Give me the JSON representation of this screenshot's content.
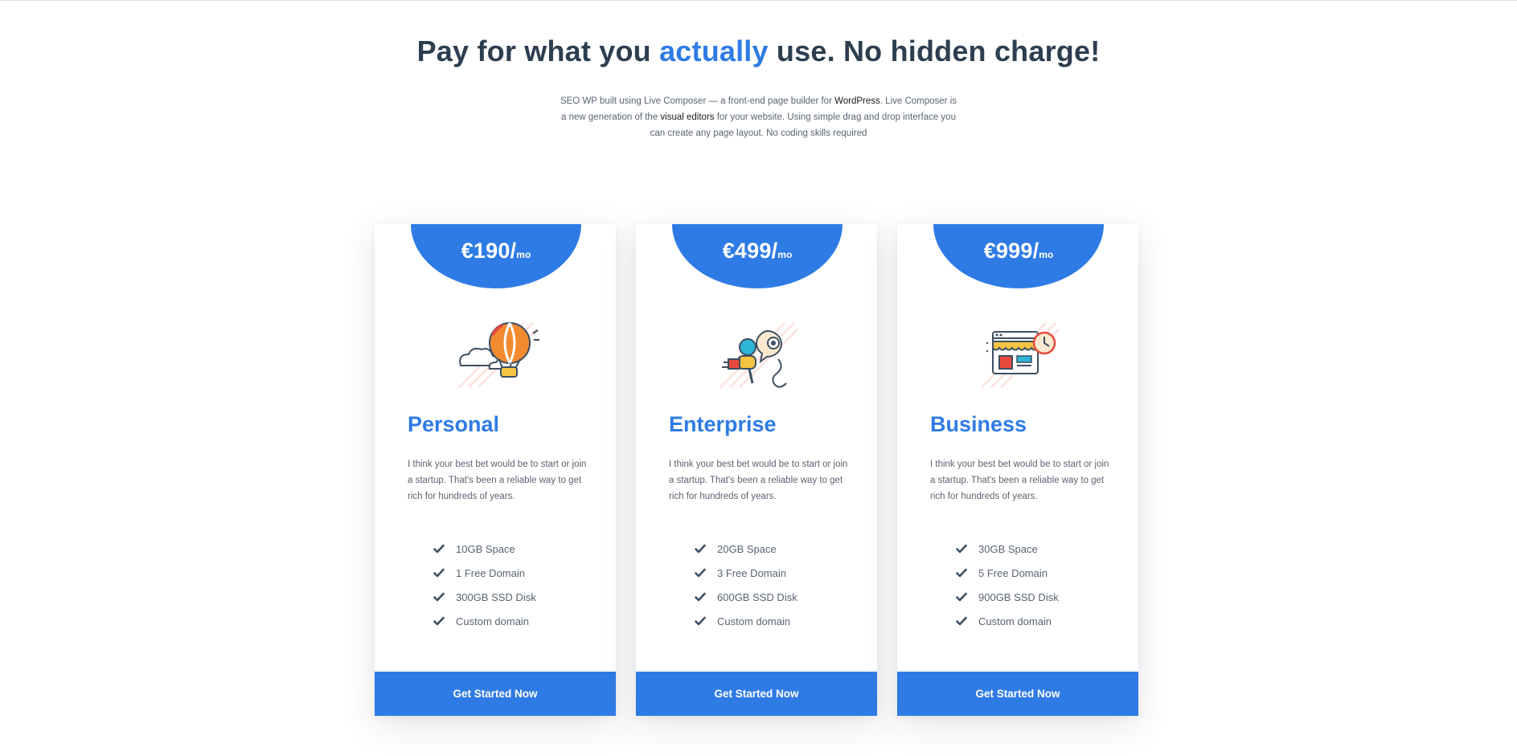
{
  "header": {
    "headline_before": "Pay for what you ",
    "headline_accent": "actually",
    "headline_after": " use. No hidden charge!",
    "intro_part1": "SEO WP built using Live Composer — a front-end page builder for ",
    "intro_link1": "WordPress",
    "intro_part2": ". Live Composer is a new generation of the ",
    "intro_link2": "visual editors",
    "intro_part3": " for your website. Using simple drag and drop interface you can create any page layout. No coding skills required"
  },
  "plans": [
    {
      "price": "€190/",
      "period": "mo",
      "illustration": "hot-air-balloon-icon",
      "name": "Personal",
      "description": "I think your best bet would be to start or join a startup. That's been a reliable way to get rich for hundreds of years.",
      "features": [
        "10GB Space",
        "1 Free Domain",
        "300GB SSD Disk",
        "Custom domain"
      ],
      "cta": "Get Started Now"
    },
    {
      "price": "€499/",
      "period": "mo",
      "illustration": "microphone-chat-icon",
      "name": "Enterprise",
      "description": "I think your best bet would be to start or join a startup. That's been a reliable way to get rich for hundreds of years.",
      "features": [
        "20GB Space",
        "3 Free Domain",
        "600GB SSD Disk",
        "Custom domain"
      ],
      "cta": "Get Started Now"
    },
    {
      "price": "€999/",
      "period": "mo",
      "illustration": "online-shop-icon",
      "name": "Business",
      "description": "I think your best bet would be to start or join a startup. That's been a reliable way to get rich for hundreds of years.",
      "features": [
        "30GB Space",
        "5 Free Domain",
        "900GB SSD Disk",
        "Custom domain"
      ],
      "cta": "Get Started Now"
    }
  ],
  "colors": {
    "accent": "#2f7be5",
    "heading": "#2d3e50",
    "body_text": "#5a6472",
    "check": "#3d4f63"
  }
}
